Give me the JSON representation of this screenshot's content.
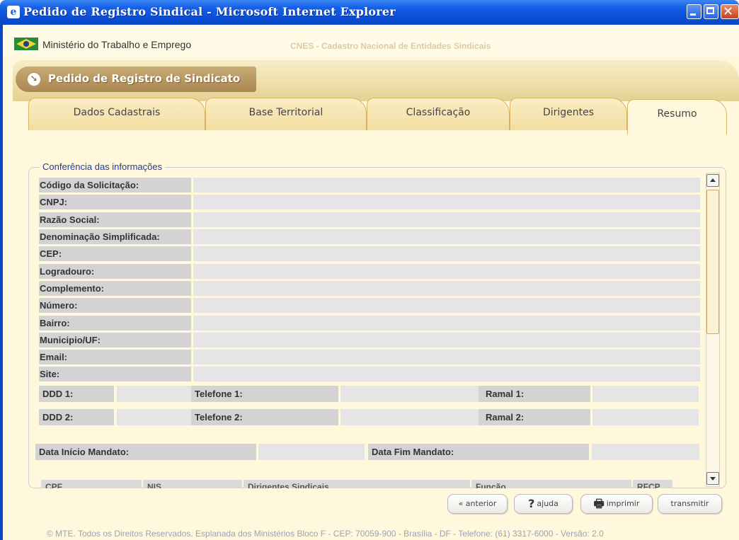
{
  "window": {
    "title": "Pedido de Registro Sindical - Microsoft Internet Explorer"
  },
  "header": {
    "ministry": "Ministério do Trabalho e Emprego",
    "system": "CNES - Cadastro Nacional de Entidades Sindicais"
  },
  "banner": {
    "title": "Pedido de Registro de Sindicato"
  },
  "tabs": [
    {
      "label": "Dados Cadastrais"
    },
    {
      "label": "Base Territorial"
    },
    {
      "label": "Classificação"
    },
    {
      "label": "Dirigentes"
    },
    {
      "label": "Resumo"
    }
  ],
  "summary": {
    "legend": "Conferência das informações",
    "fields": [
      {
        "label": "Código da Solicitação:",
        "value": ""
      },
      {
        "label": "CNPJ:",
        "value": ""
      },
      {
        "label": "Razão Social:",
        "value": ""
      },
      {
        "label": "Denominação Simplificada:",
        "value": ""
      },
      {
        "label": "CEP:",
        "value": ""
      },
      {
        "label": "Logradouro:",
        "value": ""
      },
      {
        "label": "Complemento:",
        "value": ""
      },
      {
        "label": "Número:",
        "value": ""
      },
      {
        "label": "Bairro:",
        "value": ""
      },
      {
        "label": "Municipio/UF:",
        "value": ""
      },
      {
        "label": "Email:",
        "value": ""
      },
      {
        "label": "Site:",
        "value": ""
      }
    ],
    "phones": [
      {
        "ddd_label": "DDD 1:",
        "phone_label": "Telefone 1:",
        "ramal_label": "Ramal 1:"
      },
      {
        "ddd_label": "DDD 2:",
        "phone_label": "Telefone 2:",
        "ramal_label": "Ramal 2:"
      }
    ],
    "mandate": {
      "start_label": "Data Início Mandato:",
      "end_label": "Data Fim Mandato:"
    },
    "dirigentes_headers": [
      "CPF",
      "NIS",
      "Dirigentes Sindicais",
      "Função",
      "RFCP"
    ]
  },
  "buttons": {
    "previous": "« anterior",
    "help": "ajuda",
    "print": "imprimir",
    "submit": "transmitir"
  },
  "footer": "© MTE. Todos os Direitos Reservados. Esplanada dos Ministérios Bloco F - CEP: 70059-900 - Brasília - DF - Telefone: (61) 3317-6000 - Versão: 2.0"
}
